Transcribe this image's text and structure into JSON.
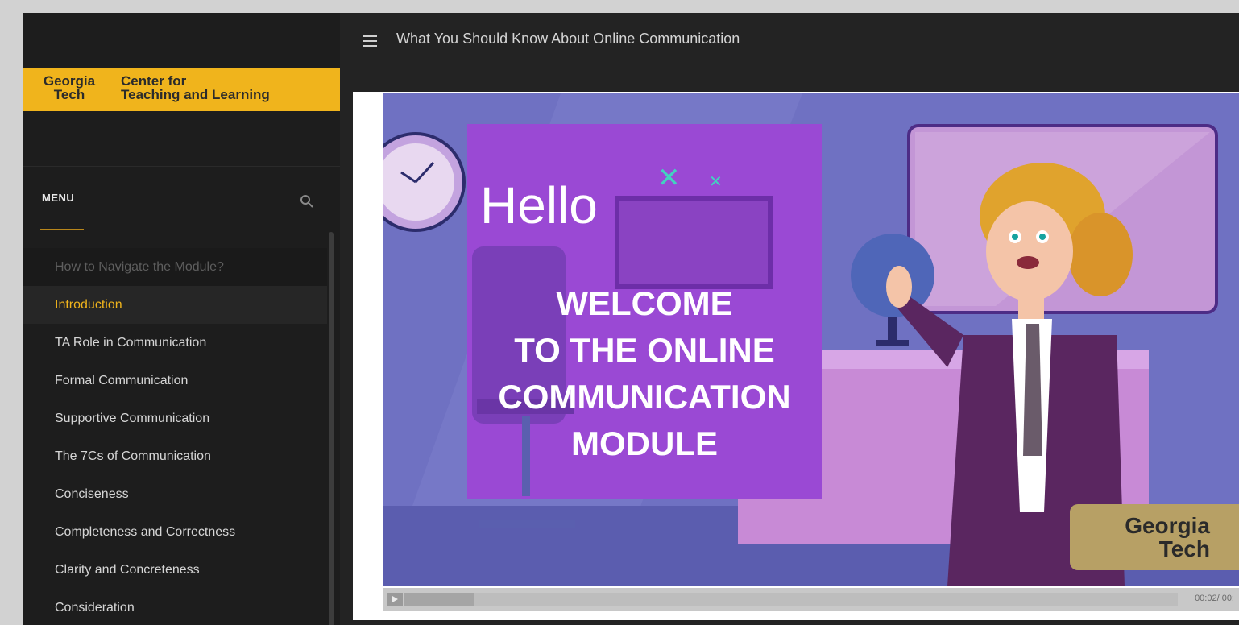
{
  "header": {
    "title": "What You Should Know About Online Communication"
  },
  "sidebar": {
    "logo": {
      "left_line1": "Georgia",
      "left_line2": "Tech",
      "right_line1": "Center for",
      "right_line2": "Teaching and Learning"
    },
    "menu_label": "MENU",
    "items": [
      {
        "label": "How to Navigate the Module?",
        "state": "muted"
      },
      {
        "label": "Introduction",
        "state": "active"
      },
      {
        "label": "TA Role in Communication",
        "state": "normal"
      },
      {
        "label": "Formal Communication",
        "state": "normal"
      },
      {
        "label": "Supportive Communication",
        "state": "normal"
      },
      {
        "label": "The 7Cs of Communication",
        "state": "normal"
      },
      {
        "label": "Conciseness",
        "state": "normal"
      },
      {
        "label": "Completeness and Correctness",
        "state": "normal"
      },
      {
        "label": "Clarity and Concreteness",
        "state": "normal"
      },
      {
        "label": "Consideration",
        "state": "normal"
      }
    ]
  },
  "slide": {
    "hello": "Hello",
    "welcome_line1": "WELCOME",
    "welcome_line2": "TO THE ONLINE",
    "welcome_line3": "COMMUNICATION",
    "welcome_line4": "MODULE",
    "badge_line1": "Georgia",
    "badge_line2": "Tech"
  },
  "player": {
    "time": "00:02/ 00:",
    "progress": 0.09
  },
  "colors": {
    "accent_gold": "#f0b41c",
    "sidebar_bg": "#1d1d1d",
    "slide_purple": "#6f71c2",
    "panel_purple": "#9a49d4"
  }
}
